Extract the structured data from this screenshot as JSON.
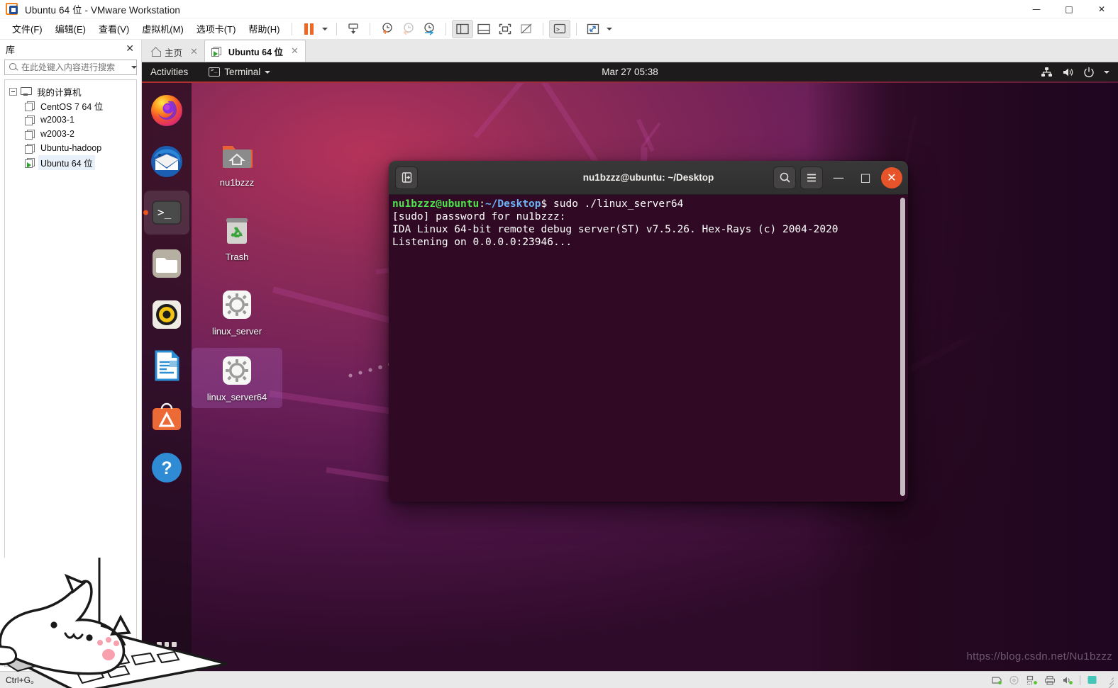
{
  "window": {
    "title": "Ubuntu 64 位 - VMware Workstation",
    "logo_icon": "vmware-logo-icon",
    "controls": {
      "minimize": "—",
      "minimize_icon": "minimize-icon",
      "maximize": "□",
      "maximize_icon": "maximize-icon",
      "close": "✕",
      "close_icon": "close-icon"
    }
  },
  "menubar": {
    "items": [
      {
        "label": "文件(F)",
        "name": "menu-file"
      },
      {
        "label": "编辑(E)",
        "name": "menu-edit"
      },
      {
        "label": "查看(V)",
        "name": "menu-view"
      },
      {
        "label": "虚拟机(M)",
        "name": "menu-vm"
      },
      {
        "label": "选项卡(T)",
        "name": "menu-tabs"
      },
      {
        "label": "帮助(H)",
        "name": "menu-help"
      }
    ]
  },
  "toolbar": {
    "buttons": [
      {
        "name": "suspend-button",
        "icon": "pause-icon"
      },
      {
        "name": "power-dropdown",
        "icon": "chevron-down-icon"
      },
      {
        "name": "send-ctrl-alt-del-button",
        "icon": "send-keys-icon"
      },
      {
        "name": "snapshot-take-button",
        "icon": "clock-plus-icon"
      },
      {
        "name": "snapshot-revert-button",
        "icon": "clock-back-icon"
      },
      {
        "name": "snapshot-manager-button",
        "icon": "clock-manage-icon"
      },
      {
        "name": "show-library-button",
        "icon": "sidebar-panel-icon"
      },
      {
        "name": "show-thumbnail-bar-button",
        "icon": "bottom-panel-icon"
      },
      {
        "name": "fullscreen-button",
        "icon": "fullscreen-icon"
      },
      {
        "name": "unity-mode-button",
        "icon": "unity-mode-icon"
      },
      {
        "name": "console-view-button",
        "icon": "console-icon"
      },
      {
        "name": "stretch-button",
        "icon": "expand-arrows-icon"
      },
      {
        "name": "stretch-dropdown",
        "icon": "chevron-down-icon"
      }
    ]
  },
  "library": {
    "title": "库",
    "close_icon": "close-icon",
    "search": {
      "placeholder": "在此处键入内容进行搜索",
      "value": "",
      "icon": "search-icon",
      "dropdown_icon": "chevron-down-icon"
    },
    "root": {
      "label": "我的计算机",
      "icon": "monitor-icon"
    },
    "items": [
      {
        "label": "CentOS 7 64 位",
        "icon": "vm-icon",
        "running": false,
        "selected": false
      },
      {
        "label": "w2003-1",
        "icon": "vm-icon",
        "running": false,
        "selected": false
      },
      {
        "label": "w2003-2",
        "icon": "vm-icon",
        "running": false,
        "selected": false
      },
      {
        "label": "Ubuntu-hadoop",
        "icon": "vm-icon",
        "running": false,
        "selected": false
      },
      {
        "label": "Ubuntu 64 位",
        "icon": "vm-running-icon",
        "running": true,
        "selected": true
      }
    ]
  },
  "tabs": [
    {
      "label": "主页",
      "icon": "home-icon",
      "active": false,
      "close_icon": "close-icon"
    },
    {
      "label": "Ubuntu 64 位",
      "icon": "vm-running-icon",
      "active": true,
      "close_icon": "close-icon"
    }
  ],
  "guest": {
    "topbar": {
      "activities": "Activities",
      "app_name": "Terminal",
      "app_icon": "terminal-icon",
      "app_dropdown_icon": "chevron-down-icon",
      "clock": "Mar 27  05:38",
      "system_icons": [
        "network-icon",
        "volume-icon",
        "power-icon",
        "chevron-down-icon"
      ]
    },
    "dock": {
      "items": [
        {
          "name": "dock-item-firefox",
          "icon": "firefox-icon",
          "running": false
        },
        {
          "name": "dock-item-thunderbird",
          "icon": "thunderbird-icon",
          "running": false
        },
        {
          "name": "dock-item-terminal",
          "icon": "terminal-icon",
          "running": true
        },
        {
          "name": "dock-item-files",
          "icon": "files-folder-icon",
          "running": false
        },
        {
          "name": "dock-item-rhythmbox",
          "icon": "rhythmbox-icon",
          "running": false
        },
        {
          "name": "dock-item-libreoffice-writer",
          "icon": "libreoffice-writer-icon",
          "running": false
        },
        {
          "name": "dock-item-ubuntu-software",
          "icon": "ubuntu-software-icon",
          "running": false
        },
        {
          "name": "dock-item-help",
          "icon": "help-icon",
          "running": false
        }
      ],
      "show_apps_icon": "app-grid-icon"
    },
    "desktop_icons": [
      {
        "label": "nu1bzzz",
        "icon": "home-folder-icon",
        "selected": false
      },
      {
        "label": "Trash",
        "icon": "trash-icon",
        "selected": false
      },
      {
        "label": "linux_server",
        "icon": "executable-gear-icon",
        "selected": false
      },
      {
        "label": "linux_server64",
        "icon": "executable-gear-icon",
        "selected": true
      }
    ],
    "terminal": {
      "title": "nu1bzzz@ubuntu: ~/Desktop",
      "new_tab_icon": "new-tab-icon",
      "search_icon": "search-icon",
      "menu_icon": "hamburger-menu-icon",
      "minimize_icon": "minimize-icon",
      "maximize_icon": "maximize-icon",
      "close_icon": "close-icon",
      "minimize_label": "—",
      "maximize_label": "□",
      "close_label": "✕",
      "prompt_user": "nu1bzzz@ubuntu",
      "prompt_path": "~/Desktop",
      "prompt_sigil": "$ ",
      "command": "sudo ./linux_server64",
      "lines": [
        "[sudo] password for nu1bzzz:",
        "IDA Linux 64-bit remote debug server(ST) v7.5.26. Hex-Rays (c) 2004-2020",
        "Listening on 0.0.0.0:23946..."
      ]
    }
  },
  "statusbar": {
    "text": "Ctrl+G。",
    "icons": [
      {
        "name": "hard-disk-status-icon",
        "icon": "hard-disk-icon"
      },
      {
        "name": "cd-dvd-status-icon",
        "icon": "cd-dvd-icon"
      },
      {
        "name": "network-status-icon",
        "icon": "network-icon"
      },
      {
        "name": "printer-status-icon",
        "icon": "printer-icon"
      },
      {
        "name": "sound-status-icon",
        "icon": "sound-icon"
      },
      {
        "name": "usb-status-icon",
        "icon": "usb-icon"
      }
    ],
    "resize_grip_icon": "resize-grip-icon"
  },
  "watermark": {
    "text": "https://blog.csdn.net/Nu1bzzz"
  },
  "overlay": {
    "mascot": "bongo-cat-overlay-icon"
  },
  "colors": {
    "ubuntu_orange": "#e95420",
    "terminal_bg": "#300a24",
    "topbar_bg": "#1d1b1b",
    "vmware_chrome": "#f0f0f0",
    "prompt_green": "#4ee44e",
    "prompt_blue": "#6cb3f7"
  }
}
